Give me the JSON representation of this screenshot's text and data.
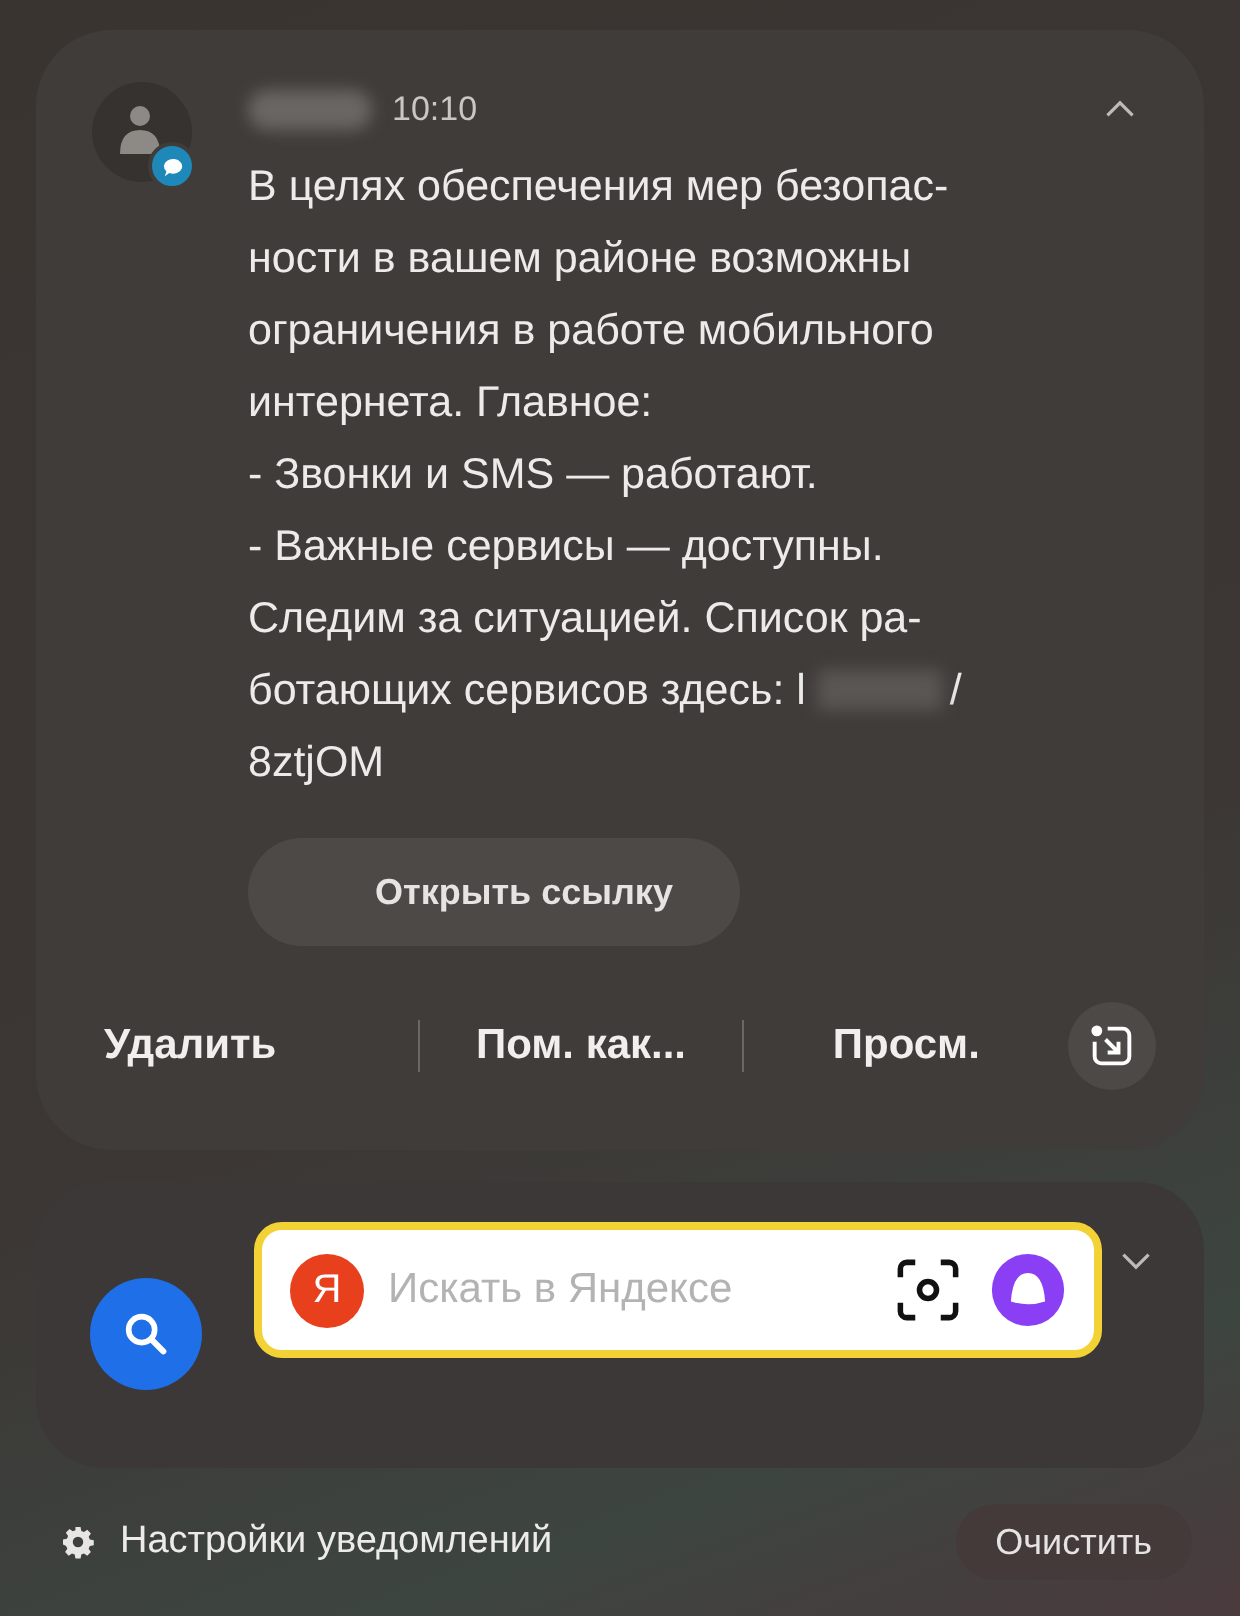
{
  "notification": {
    "time": "10:10",
    "expanded": true,
    "message_lines": [
      {
        "text": "В целях обеспечения мер безопас-"
      },
      {
        "text": "ности в вашем районе возможны"
      },
      {
        "text": "ограничения в работе мобильного"
      },
      {
        "text": "интернета. Главное:"
      },
      {
        "text": "- Звонки и SMS — работают."
      },
      {
        "text": "- Важные сервисы — доступны."
      },
      {
        "text": "Следим за ситуацией. Список ра-"
      },
      {
        "text": "ботающих сервисов здесь: l",
        "redacted_tail": "/"
      },
      {
        "text": "8ztjOM"
      }
    ],
    "link_button": "Открыть ссылку",
    "actions": [
      "Удалить",
      "Пом. как...",
      "Просм."
    ]
  },
  "search_widget": {
    "logo_letter": "Я",
    "placeholder": "Искать в Яндексе"
  },
  "footer": {
    "settings": "Настройки уведомлений",
    "clear_button": "Очистить"
  }
}
